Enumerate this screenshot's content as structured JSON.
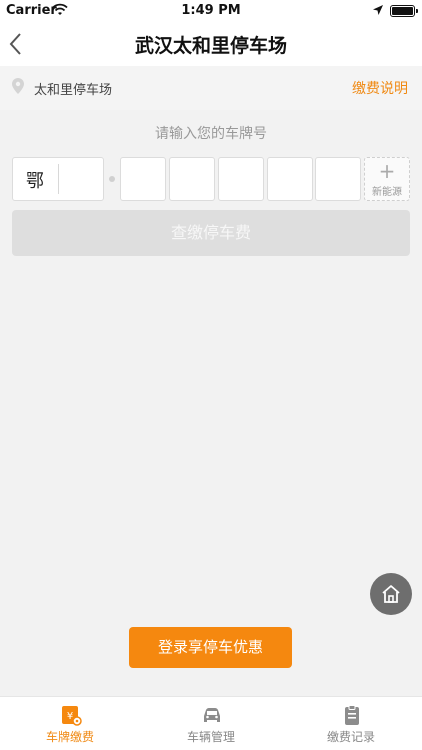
{
  "status_bar": {
    "carrier": "Carrier",
    "time": "1:49 PM"
  },
  "nav": {
    "title": "武汉太和里停车场"
  },
  "location": {
    "name": "太和里停车场",
    "explain_link": "缴费说明"
  },
  "plate": {
    "prompt": "请输入您的车牌号",
    "province": "鄂",
    "new_energy_plus": "+",
    "new_energy_label": "新能源"
  },
  "query_button": "查缴停车费",
  "login_button": "登录享停车优惠",
  "tabs": [
    {
      "label": "车牌缴费",
      "icon": "pay-icon",
      "active": true
    },
    {
      "label": "车辆管理",
      "icon": "car-icon",
      "active": false
    },
    {
      "label": "缴费记录",
      "icon": "clipboard-icon",
      "active": false
    }
  ],
  "colors": {
    "accent": "#f5880f",
    "disabled_button": "#dedede",
    "home_button": "#6e6e6e"
  }
}
